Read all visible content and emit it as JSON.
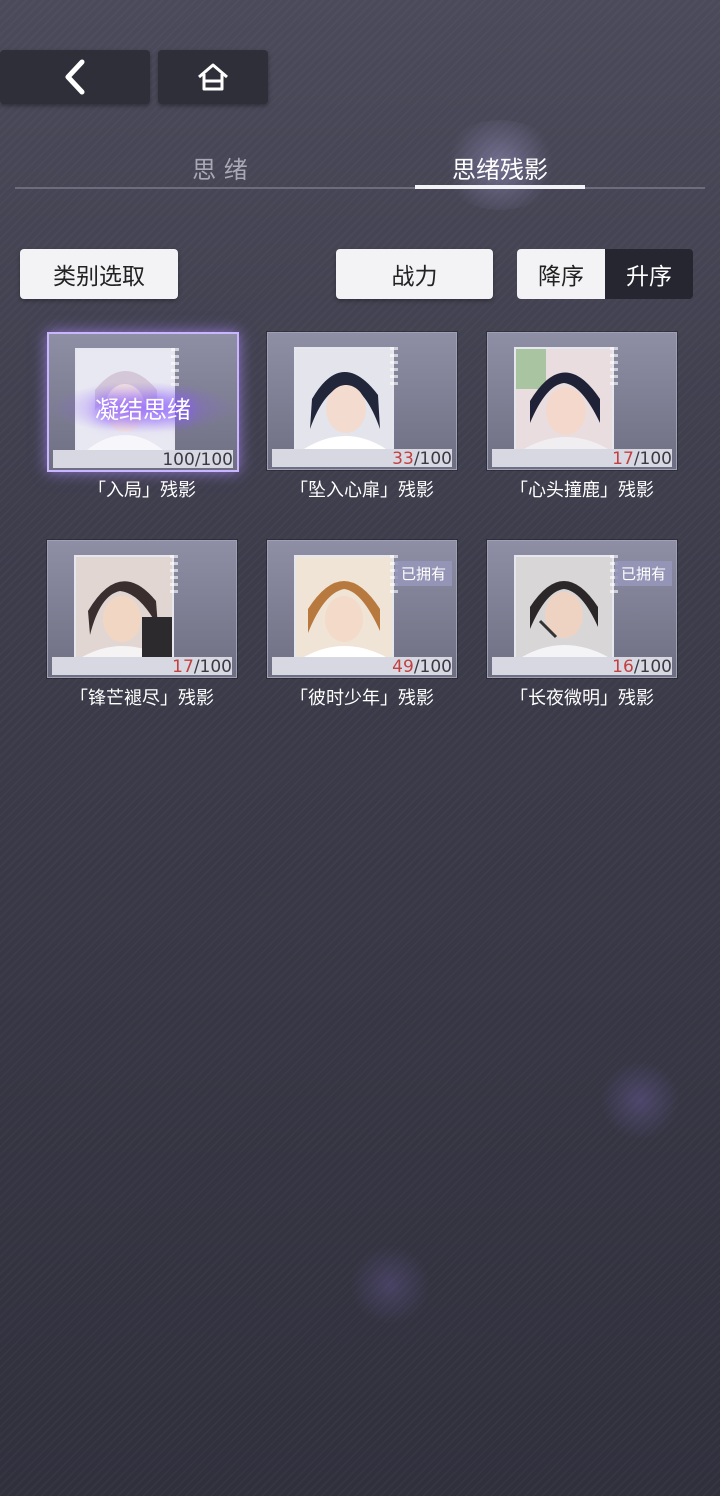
{
  "nav": {
    "back_icon": "chevron-left-icon",
    "home_icon": "home-icon"
  },
  "tabs": [
    {
      "label": "思 绪",
      "active": false
    },
    {
      "label": "思绪残影",
      "active": true
    }
  ],
  "filters": {
    "category_label": "类别选取",
    "sort_field_label": "战力"
  },
  "sort": {
    "desc_label": "降序",
    "asc_label": "升序",
    "selected": "降序"
  },
  "cards": [
    {
      "label": "「入局」残影",
      "current": "100",
      "total": "/100",
      "owned": "",
      "overlay": "凝结思绪"
    },
    {
      "label": "「坠入心扉」残影",
      "current": "33",
      "total": "/100",
      "owned": "",
      "overlay": ""
    },
    {
      "label": "「心头撞鹿」残影",
      "current": "17",
      "total": "/100",
      "owned": "",
      "overlay": ""
    },
    {
      "label": "「锋芒褪尽」残影",
      "current": "17",
      "total": "/100",
      "owned": "",
      "overlay": ""
    },
    {
      "label": "「彼时少年」残影",
      "current": "49",
      "total": "/100",
      "owned": "已拥有",
      "overlay": ""
    },
    {
      "label": "「长夜微明」残影",
      "current": "16",
      "total": "/100",
      "owned": "已拥有",
      "overlay": ""
    }
  ],
  "colors": {
    "accent_glow": "#8a5cff",
    "count_low": "#c24040",
    "pill_bg": "#f3f3f5"
  }
}
